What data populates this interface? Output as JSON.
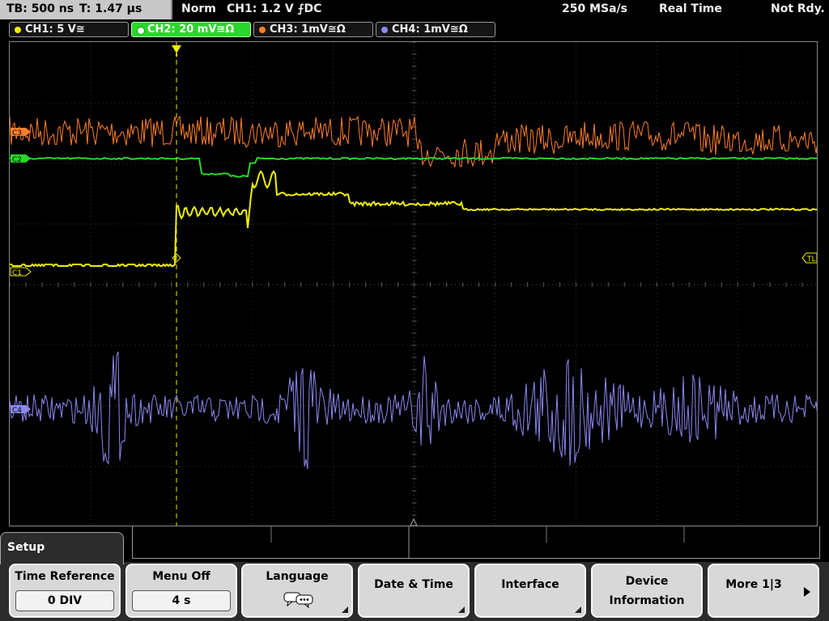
{
  "status": {
    "timebase": "TB: 500 ns",
    "trigger_time": "T: 1.47 µs",
    "mode": "Norm",
    "trigger_info": "CH1: 1.2 V ⨍DC",
    "sample_rate": "250 MSa/s",
    "acq_mode": "Real Time",
    "state": "Not Rdy."
  },
  "channels": [
    {
      "label": "CH1: 5 V≅",
      "color": "#f0f000",
      "marker": "C1"
    },
    {
      "label": "CH2: 20 mV≅Ω",
      "color": "#2ad62a",
      "marker": "C2"
    },
    {
      "label": "CH3: 1mV≅Ω",
      "color": "#ff7f27",
      "marker": "C3"
    },
    {
      "label": "CH4: 1mV≅Ω",
      "color": "#8c88f0",
      "marker": "C4"
    }
  ],
  "markers": {
    "trigger_level": "TL"
  },
  "menu": {
    "title": "Setup",
    "keys": [
      {
        "label": "Time Reference",
        "value": "0 DIV"
      },
      {
        "label": "Menu Off",
        "value": "4 s"
      },
      {
        "label": "Language",
        "icon": "speech-bubbles-icon"
      },
      {
        "label": "Date & Time"
      },
      {
        "label": "Interface"
      },
      {
        "label_line1": "Device",
        "label_line2": "Information"
      },
      {
        "label": "More 1|3"
      }
    ]
  }
}
